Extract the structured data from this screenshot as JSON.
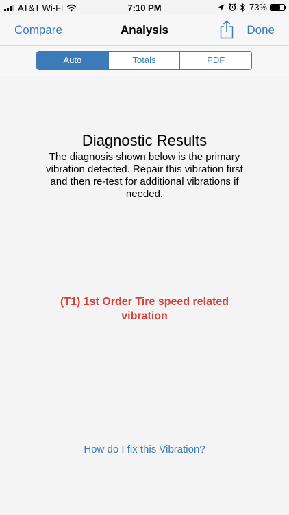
{
  "status_bar": {
    "carrier": "AT&T Wi-Fi",
    "time": "7:10 PM",
    "battery_percent": "73%",
    "battery_level": 0.73
  },
  "nav": {
    "left_label": "Compare",
    "title": "Analysis",
    "right_label": "Done"
  },
  "segments": [
    {
      "label": "Auto",
      "selected": true
    },
    {
      "label": "Totals",
      "selected": false
    },
    {
      "label": "PDF",
      "selected": false
    }
  ],
  "results": {
    "title": "Diagnostic Results",
    "description": "The diagnosis shown below is the primary vibration detected. Repair this vibration first and then re-test for additional vibrations if needed.",
    "diagnosis": "(T1) 1st Order Tire speed related vibration",
    "fix_link": "How do I fix this Vibration?"
  },
  "colors": {
    "accent": "#3a7bb8",
    "diagnosis": "#d9403a",
    "background": "#f4f4f4"
  },
  "icons": [
    "cellular-signal-icon",
    "wifi-icon",
    "location-arrow-icon",
    "alarm-icon",
    "bluetooth-icon",
    "battery-icon",
    "share-icon"
  ]
}
